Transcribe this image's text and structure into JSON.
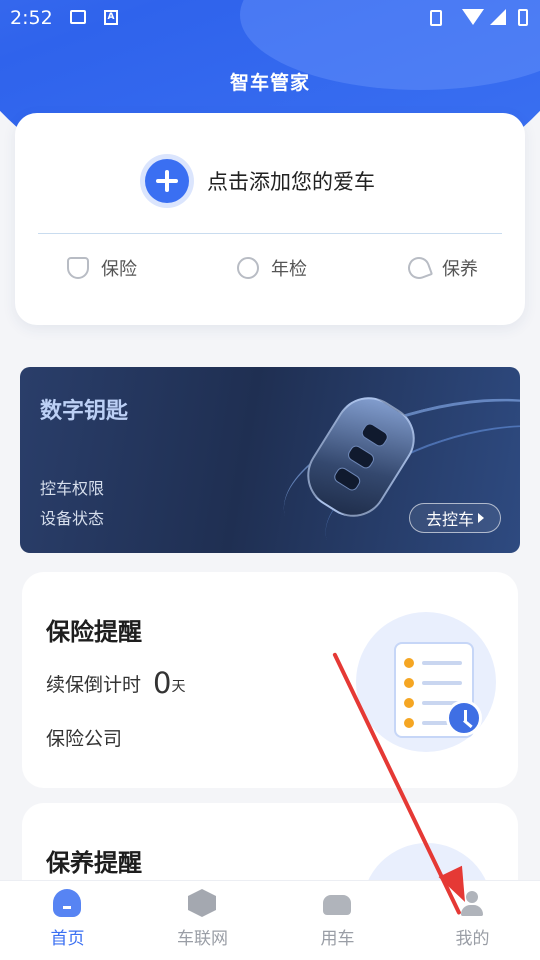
{
  "status_bar": {
    "time": "2:52",
    "left_icons": [
      "image-icon",
      "a-icon"
    ],
    "right_icons": [
      "vibrate-icon",
      "wifi-icon",
      "signal-icon",
      "battery-icon"
    ]
  },
  "header": {
    "title": "智车管家"
  },
  "car_card": {
    "add_label": "点击添加您的爱车",
    "services": [
      {
        "label": "保险",
        "icon": "shield-icon"
      },
      {
        "label": "年检",
        "icon": "target-icon"
      },
      {
        "label": "保养",
        "icon": "wrench-icon"
      }
    ]
  },
  "digital_key": {
    "title": "数字钥匙",
    "lines": [
      "控车权限",
      "设备状态"
    ],
    "button_label": "去控车"
  },
  "insurance_reminder": {
    "title": "保险提醒",
    "countdown_label": "续保倒计时",
    "countdown_value": "0",
    "countdown_unit": "天",
    "company_label": "保险公司"
  },
  "maintenance_reminder": {
    "title": "保养提醒"
  },
  "bottom_nav": {
    "items": [
      {
        "label": "首页",
        "icon": "home-icon",
        "active": true
      },
      {
        "label": "车联网",
        "icon": "cube-icon",
        "active": false
      },
      {
        "label": "用车",
        "icon": "car-icon",
        "active": false
      },
      {
        "label": "我的",
        "icon": "user-icon",
        "active": false
      }
    ]
  },
  "colors": {
    "accent": "#3a6ff2",
    "header_blue": "#2f63ec",
    "annotation_red": "#e53935",
    "banner_dark": "#1f2f52"
  }
}
